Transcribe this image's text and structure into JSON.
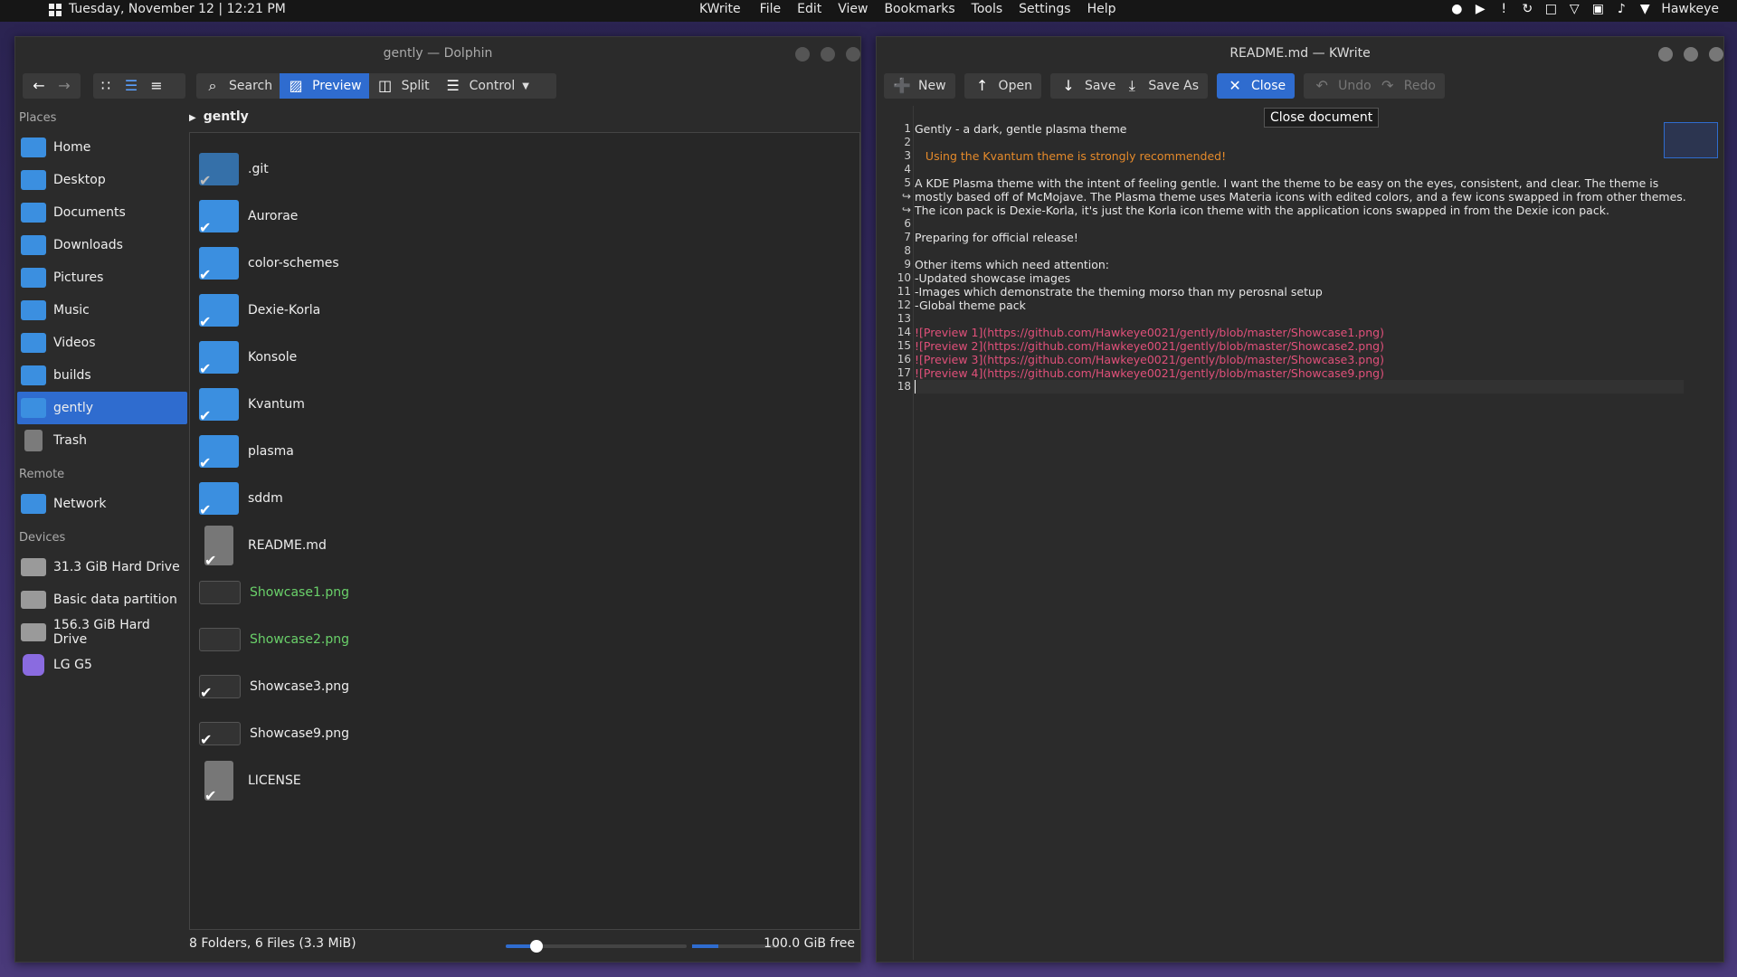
{
  "panel": {
    "datetime": "Tuesday, November 12 | 12:21 PM",
    "app": "KWrite",
    "menu": [
      "File",
      "Edit",
      "View",
      "Bookmarks",
      "Tools",
      "Settings",
      "Help"
    ],
    "user": "Hawkeye"
  },
  "dolphin": {
    "title": "gently — Dolphin",
    "toolbar": {
      "search": "Search",
      "preview": "Preview",
      "split": "Split",
      "control": "Control"
    },
    "places_header": "Places",
    "places": [
      "Home",
      "Desktop",
      "Documents",
      "Downloads",
      "Pictures",
      "Music",
      "Videos",
      "builds",
      "gently",
      "Trash"
    ],
    "remote_header": "Remote",
    "remote": [
      "Network"
    ],
    "devices_header": "Devices",
    "devices": [
      "31.3 GiB Hard Drive",
      "Basic data partition",
      "156.3 GiB Hard Drive",
      "LG G5"
    ],
    "breadcrumb": "gently",
    "files": [
      ".git",
      "Aurorae",
      "color-schemes",
      "Dexie-Korla",
      "Konsole",
      "Kvantum",
      "plasma",
      "sddm",
      "README.md",
      "Showcase1.png",
      "Showcase2.png",
      "Showcase3.png",
      "Showcase9.png",
      "LICENSE"
    ],
    "status": "8 Folders, 6 Files (3.3 MiB)",
    "free": "100.0 GiB free",
    "zoom_fraction": 0.17,
    "space_fraction": 0.3
  },
  "kwrite": {
    "title": "README.md — KWrite",
    "toolbar": {
      "new": "New",
      "open": "Open",
      "save": "Save",
      "saveas": "Save As",
      "close": "Close",
      "undo": "Undo",
      "redo": "Redo"
    },
    "tooltip": "Close document",
    "gutter": [
      "1",
      "2",
      "3",
      "4",
      "5",
      "↪",
      "↪",
      "6",
      "7",
      "8",
      "9",
      "10",
      "11",
      "12",
      "13",
      "14",
      "15",
      "16",
      "17",
      "18"
    ],
    "lines": [
      "Gently - a dark, gentle plasma theme",
      "",
      "   Using the Kvantum theme is strongly recommended!",
      "",
      "A KDE Plasma theme with the intent of feeling gentle. I want the theme to be easy on the eyes, consistent, and clear. The theme is",
      "mostly based off of McMojave. The Plasma theme uses Materia icons with edited colors, and a few icons swapped in from other themes.",
      "The icon pack is Dexie-Korla, it's just the Korla icon theme with the application icons swapped in from the Dexie icon pack.",
      "",
      "Preparing for official release!",
      "",
      "Other items which need attention:",
      "-Updated showcase images",
      "-Images which demonstrate the theming morso than my perosnal setup",
      "-Global theme pack",
      "",
      "![Preview 1](https://github.com/Hawkeye0021/gently/blob/master/Showcase1.png)",
      "![Preview 2](https://github.com/Hawkeye0021/gently/blob/master/Showcase2.png)",
      "![Preview 3](https://github.com/Hawkeye0021/gently/blob/master/Showcase3.png)",
      "![Preview 4](https://github.com/Hawkeye0021/gently/blob/master/Showcase9.png)",
      ""
    ]
  }
}
